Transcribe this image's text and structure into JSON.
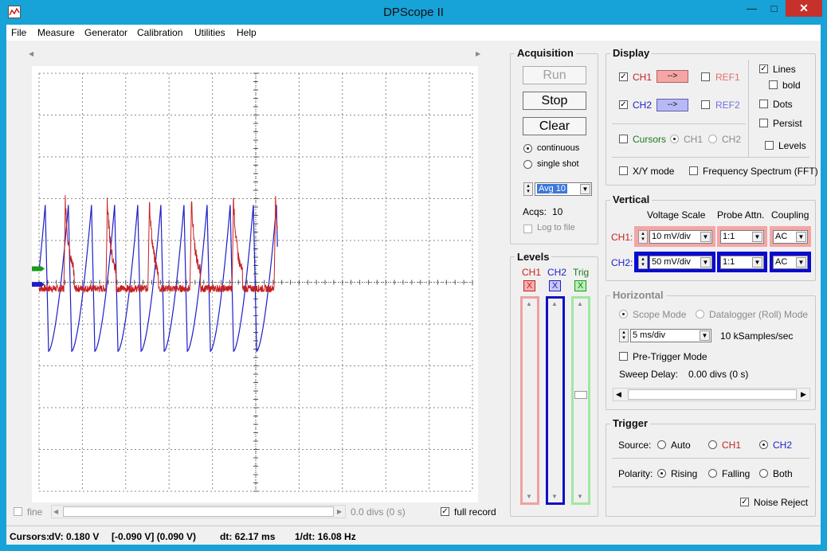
{
  "window": {
    "title": "DPScope II",
    "minimize": "—",
    "maximize": "□",
    "close": "✕"
  },
  "menu": [
    "File",
    "Measure",
    "Generator",
    "Calibration",
    "Utilities",
    "Help"
  ],
  "acquisition": {
    "title": "Acquisition",
    "run": "Run",
    "stop": "Stop",
    "clear": "Clear",
    "continuous": "continuous",
    "single_shot": "single shot",
    "avg": "Avg 10",
    "acqs_label": "Acqs:",
    "acqs_value": "10",
    "log": "Log to file"
  },
  "display": {
    "title": "Display",
    "ch1": "CH1",
    "ch1_btn": "-->",
    "ch2": "CH2",
    "ch2_btn": "-->",
    "ref1": "REF1",
    "ref2": "REF2",
    "cursors": "Cursors",
    "cur_ch1": "CH1",
    "cur_ch2": "CH2",
    "lines": "Lines",
    "bold": "bold",
    "dots": "Dots",
    "persist": "Persist",
    "levels": "Levels",
    "xy": "X/Y mode",
    "fft": "Frequency Spectrum (FFT)"
  },
  "vertical": {
    "title": "Vertical",
    "h_scale": "Voltage Scale",
    "h_probe": "Probe Attn.",
    "h_coupling": "Coupling",
    "ch1_label": "CH1:",
    "ch1_scale": "10 mV/div",
    "ch1_probe": "1:1",
    "ch1_coupling": "AC",
    "ch2_label": "CH2:",
    "ch2_scale": "50 mV/div",
    "ch2_probe": "1:1",
    "ch2_coupling": "AC"
  },
  "horizontal": {
    "title": "Horizontal",
    "scope_mode": "Scope Mode",
    "roll_mode": "Datalogger (Roll) Mode",
    "timebase": "5 ms/div",
    "rate": "10 kSamples/sec",
    "pretrigger": "Pre-Trigger Mode",
    "sweep_label": "Sweep Delay:",
    "sweep_value": "0.00 divs (0 s)"
  },
  "trigger": {
    "title": "Trigger",
    "source_label": "Source:",
    "auto": "Auto",
    "ch1": "CH1",
    "ch2": "CH2",
    "polarity_label": "Polarity:",
    "rising": "Rising",
    "falling": "Falling",
    "both": "Both",
    "noise": "Noise Reject"
  },
  "levels": {
    "title": "Levels",
    "ch1": "CH1",
    "ch2": "CH2",
    "trig": "Trig",
    "x": "X"
  },
  "bottom": {
    "fine": "fine",
    "divs": "0.0 divs (0 s)",
    "full_record": "full record"
  },
  "status": {
    "cursors": "Cursors:",
    "dv": "dV:  0.180 V",
    "dv_range": "[-0.090 V] (0.090 V)",
    "dt": "dt:  62.17 ms",
    "inv": "1/dt:  16.08 Hz"
  },
  "colors": {
    "ch1": "#c62020",
    "ch2": "#1e1ec8",
    "trig": "#1a9a1a",
    "close": "#c7312b",
    "titlebar": "#17a2d8"
  },
  "waveforms": {
    "ch2_peaks_time": [
      1.3,
      6.2,
      11.0,
      15.9,
      20.7,
      25.6
    ],
    "ch1_peaks_time": [
      5.2,
      10.1,
      14.9,
      19.8,
      24.6
    ],
    "ch2_peak_div": 3.7,
    "ch2_trough_div": -3.3,
    "ch1_spike_div": 3.2,
    "ch1_base_div": -0.3,
    "ch2_marker_div": -0.1,
    "ch1_marker_div": 0.65
  }
}
